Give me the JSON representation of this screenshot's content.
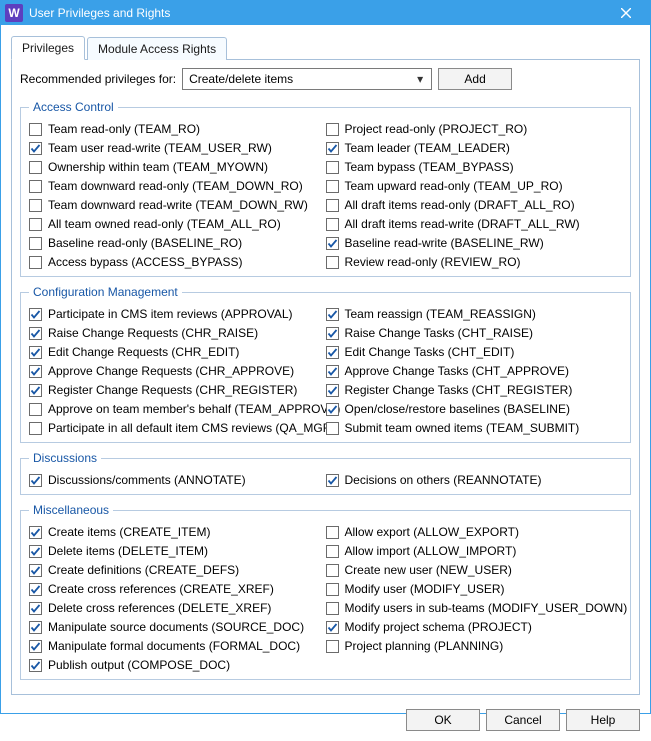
{
  "window": {
    "title": "User Privileges and Rights",
    "app_icon_letter": "W"
  },
  "tabs": [
    {
      "label": "Privileges",
      "active": true
    },
    {
      "label": "Module Access Rights",
      "active": false
    }
  ],
  "recommended": {
    "label": "Recommended privileges for:",
    "value": "Create/delete items",
    "add_label": "Add"
  },
  "groups": [
    {
      "title": "Access Control",
      "left": [
        {
          "label": "Team read-only (TEAM_RO)",
          "checked": false
        },
        {
          "label": "Team user read-write (TEAM_USER_RW)",
          "checked": true
        },
        {
          "label": "Ownership within team (TEAM_MYOWN)",
          "checked": false
        },
        {
          "label": "Team downward read-only (TEAM_DOWN_RO)",
          "checked": false
        },
        {
          "label": "Team downward read-write (TEAM_DOWN_RW)",
          "checked": false
        },
        {
          "label": "All team owned read-only (TEAM_ALL_RO)",
          "checked": false
        },
        {
          "label": "Baseline read-only (BASELINE_RO)",
          "checked": false
        },
        {
          "label": "Access bypass (ACCESS_BYPASS)",
          "checked": false
        }
      ],
      "right": [
        {
          "label": "Project read-only (PROJECT_RO)",
          "checked": false
        },
        {
          "label": "Team leader (TEAM_LEADER)",
          "checked": true
        },
        {
          "label": "Team bypass (TEAM_BYPASS)",
          "checked": false
        },
        {
          "label": "Team upward read-only (TEAM_UP_RO)",
          "checked": false
        },
        {
          "label": "All draft items read-only (DRAFT_ALL_RO)",
          "checked": false
        },
        {
          "label": "All draft items read-write (DRAFT_ALL_RW)",
          "checked": false
        },
        {
          "label": "Baseline read-write (BASELINE_RW)",
          "checked": true
        },
        {
          "label": "Review read-only (REVIEW_RO)",
          "checked": false
        }
      ]
    },
    {
      "title": "Configuration Management",
      "left": [
        {
          "label": "Participate in CMS item reviews (APPROVAL)",
          "checked": true
        },
        {
          "label": "Raise Change Requests (CHR_RAISE)",
          "checked": true
        },
        {
          "label": "Edit Change Requests (CHR_EDIT)",
          "checked": true
        },
        {
          "label": "Approve Change Requests (CHR_APPROVE)",
          "checked": true
        },
        {
          "label": "Register Change Requests (CHR_REGISTER)",
          "checked": true
        },
        {
          "label": "Approve on team member's behalf (TEAM_APPROVE)",
          "checked": false
        },
        {
          "label": "Participate in all default item CMS reviews (QA_MGR)",
          "checked": false
        }
      ],
      "right": [
        {
          "label": "Team reassign (TEAM_REASSIGN)",
          "checked": true
        },
        {
          "label": "Raise Change Tasks (CHT_RAISE)",
          "checked": true
        },
        {
          "label": "Edit Change Tasks (CHT_EDIT)",
          "checked": true
        },
        {
          "label": "Approve Change Tasks (CHT_APPROVE)",
          "checked": true
        },
        {
          "label": "Register Change Tasks (CHT_REGISTER)",
          "checked": true
        },
        {
          "label": "Open/close/restore baselines (BASELINE)",
          "checked": true
        },
        {
          "label": "Submit team owned items (TEAM_SUBMIT)",
          "checked": false
        }
      ]
    },
    {
      "title": "Discussions",
      "left": [
        {
          "label": "Discussions/comments (ANNOTATE)",
          "checked": true
        }
      ],
      "right": [
        {
          "label": "Decisions on others (REANNOTATE)",
          "checked": true
        }
      ]
    },
    {
      "title": "Miscellaneous",
      "left": [
        {
          "label": "Create items (CREATE_ITEM)",
          "checked": true
        },
        {
          "label": "Delete items (DELETE_ITEM)",
          "checked": true
        },
        {
          "label": "Create definitions (CREATE_DEFS)",
          "checked": true
        },
        {
          "label": "Create cross references (CREATE_XREF)",
          "checked": true
        },
        {
          "label": "Delete cross references (DELETE_XREF)",
          "checked": true
        },
        {
          "label": "Manipulate source documents (SOURCE_DOC)",
          "checked": true
        },
        {
          "label": "Manipulate formal documents (FORMAL_DOC)",
          "checked": true
        },
        {
          "label": "Publish output (COMPOSE_DOC)",
          "checked": true
        }
      ],
      "right": [
        {
          "label": "Allow export (ALLOW_EXPORT)",
          "checked": false
        },
        {
          "label": "Allow import (ALLOW_IMPORT)",
          "checked": false
        },
        {
          "label": "Create new user (NEW_USER)",
          "checked": false
        },
        {
          "label": "Modify user (MODIFY_USER)",
          "checked": false
        },
        {
          "label": "Modify users in sub-teams (MODIFY_USER_DOWN)",
          "checked": false
        },
        {
          "label": "Modify project schema (PROJECT)",
          "checked": true
        },
        {
          "label": "Project planning (PLANNING)",
          "checked": false
        }
      ]
    }
  ],
  "buttons": {
    "ok": "OK",
    "cancel": "Cancel",
    "help": "Help"
  }
}
